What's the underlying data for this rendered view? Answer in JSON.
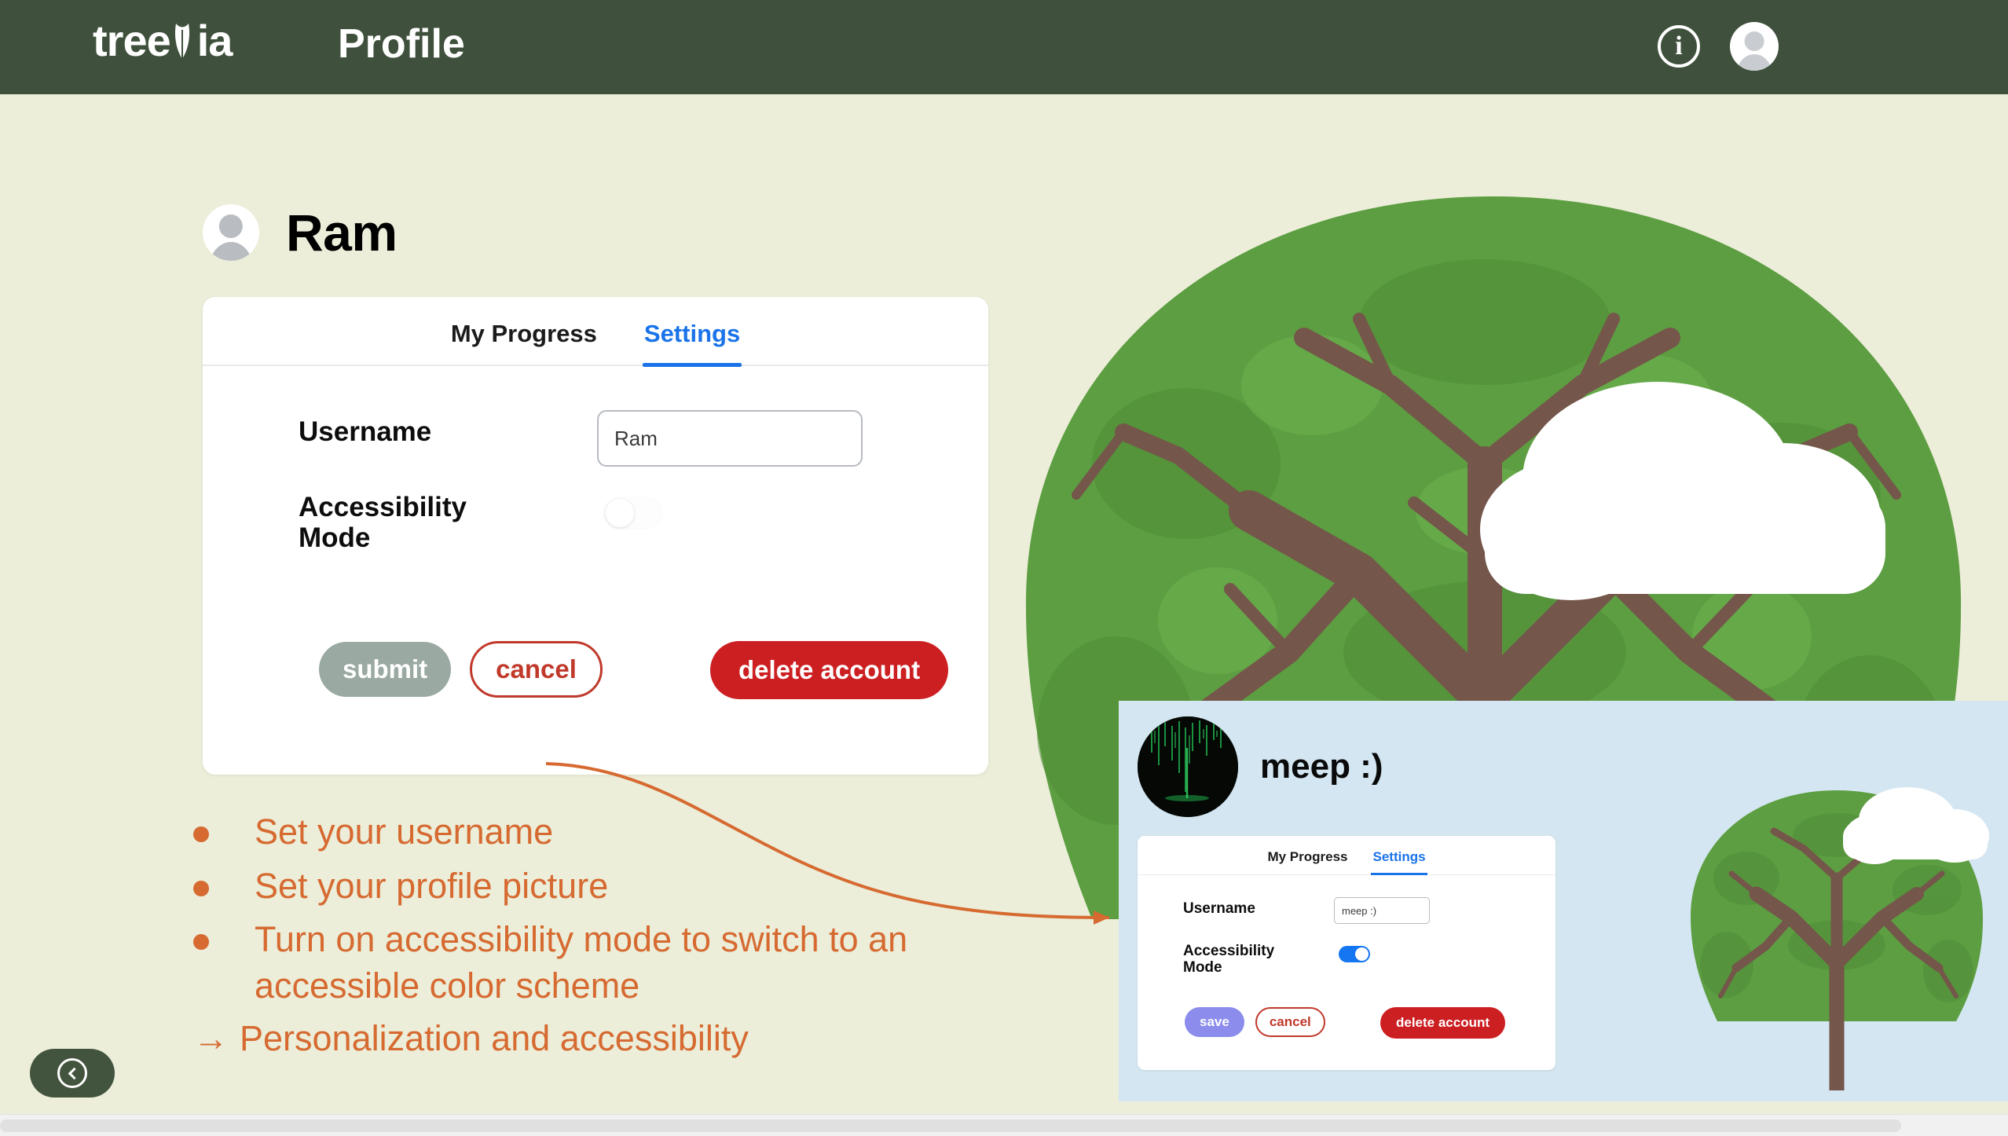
{
  "nav": {
    "brand": "tree",
    "brand_suffix": "ia",
    "title": "Profile",
    "info_icon": "info-circle-icon",
    "avatar_icon": "user-avatar-icon"
  },
  "profile": {
    "name": "Ram",
    "avatar_icon": "user-avatar-icon"
  },
  "card": {
    "tabs": [
      {
        "label": "My Progress",
        "active": false
      },
      {
        "label": "Settings",
        "active": true
      }
    ],
    "fields": {
      "username_label": "Username",
      "username_value": "Ram",
      "username_placeholder": "Username",
      "accessibility_label": "Accessibility Mode",
      "accessibility_on": false
    },
    "buttons": {
      "submit": "submit",
      "cancel": "cancel",
      "delete": "delete account"
    }
  },
  "annotations": {
    "bullets": [
      "Set your username",
      "Set your profile picture",
      "Turn on accessibility mode to switch to an accessible color scheme"
    ],
    "conclusion_arrow": "→",
    "conclusion": "Personalization and accessibility",
    "accent_color": "#d66a31"
  },
  "inset": {
    "name": "meep :)",
    "avatar_icon": "matrix-avatar-icon",
    "tabs": [
      {
        "label": "My Progress",
        "active": false
      },
      {
        "label": "Settings",
        "active": true
      }
    ],
    "fields": {
      "username_label": "Username",
      "username_value": "meep :)",
      "username_placeholder": "Username",
      "accessibility_label": "Accessibility Mode",
      "accessibility_on": true
    },
    "buttons": {
      "save": "save",
      "cancel": "cancel",
      "delete": "delete account"
    },
    "background_color": "#d4e6f1"
  },
  "collapse": {
    "icon": "chevron-left-circle-icon"
  },
  "colors": {
    "nav_bg": "#3f513c",
    "page_bg": "#eceed9",
    "tab_active": "#1a73e8",
    "delete_red": "#cc1f22",
    "cancel_red": "#c0392b",
    "submit_gray": "#9aa9a1",
    "save_purple": "#8b8ceb",
    "toggle_blue": "#1476f0",
    "leaf_green": "#5a9e3f",
    "branch_brown": "#74564a"
  }
}
